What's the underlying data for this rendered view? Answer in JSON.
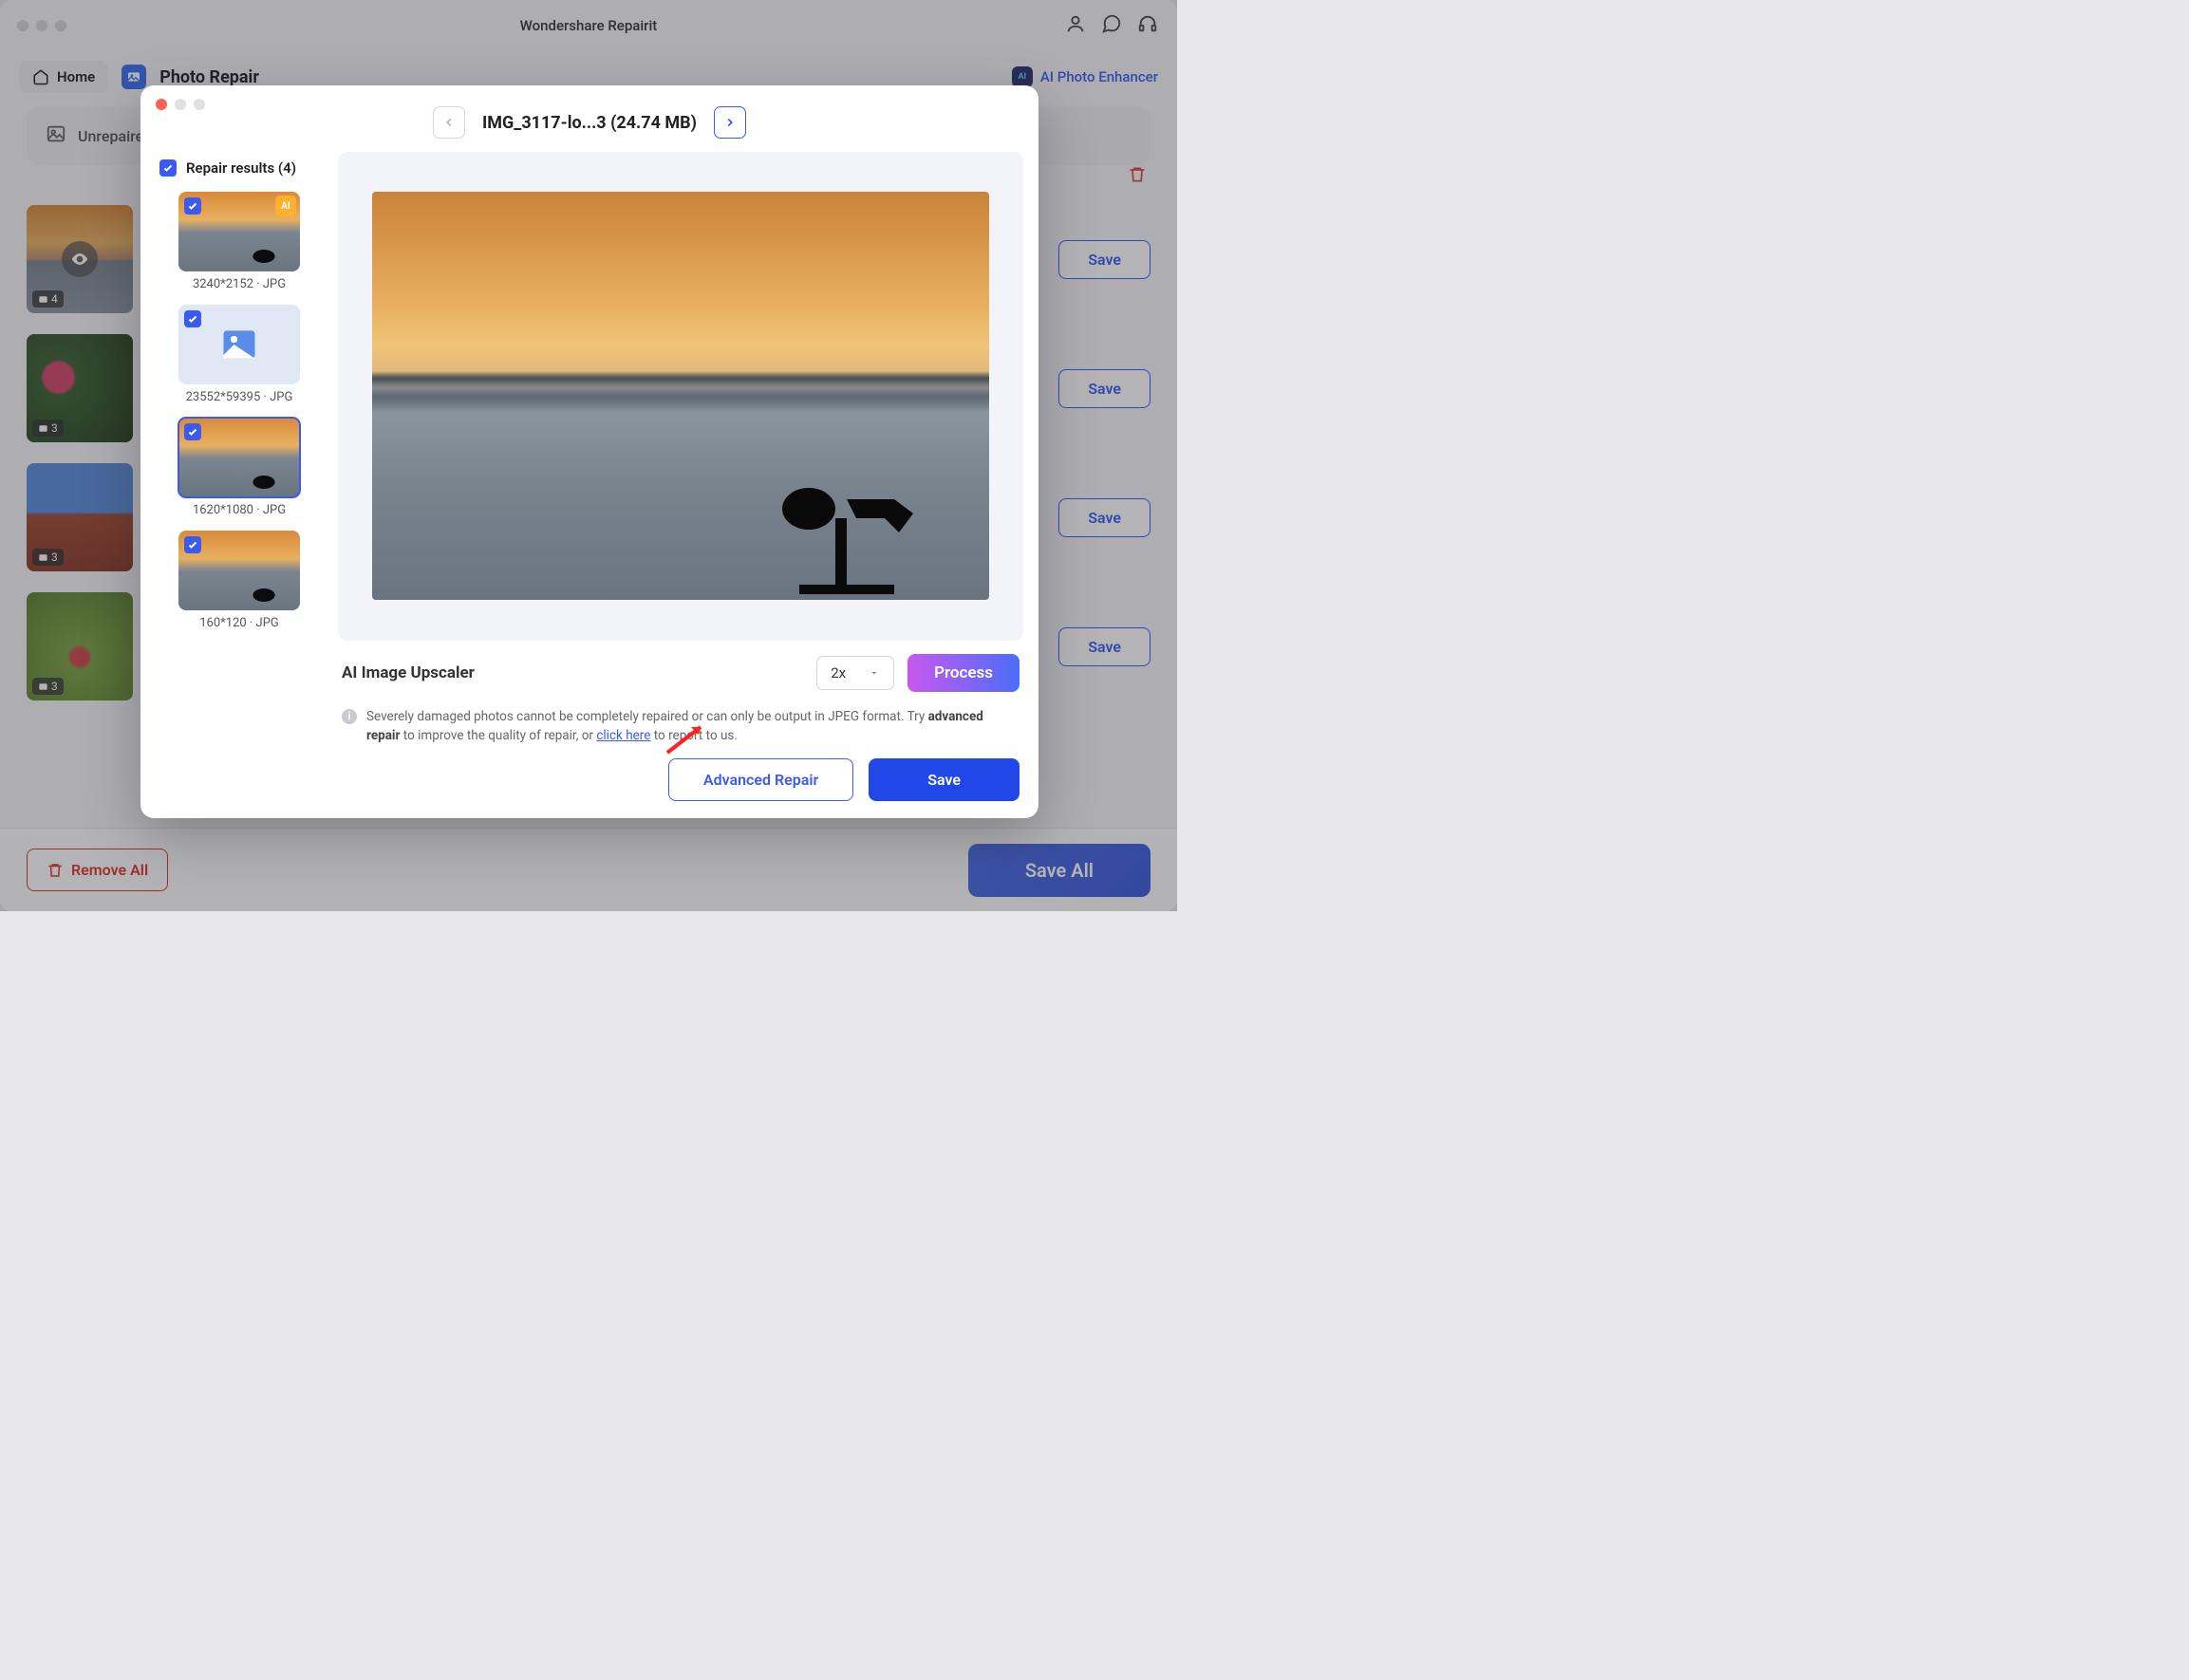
{
  "app": {
    "title": "Wondershare Repairit"
  },
  "toolbar": {
    "home_label": "Home",
    "section_title": "Photo Repair",
    "ai_enhancer_label": "AI Photo Enhancer"
  },
  "background": {
    "unrepaired_label": "Unrepaire",
    "rows": [
      {
        "count": "4",
        "save_label": "Save"
      },
      {
        "count": "3",
        "save_label": "Save"
      },
      {
        "count": "3",
        "save_label": "Save"
      },
      {
        "count": "3",
        "save_label": "Save"
      }
    ]
  },
  "bottom": {
    "remove_all": "Remove All",
    "save_all": "Save All"
  },
  "modal": {
    "title": "IMG_3117-lo...3 (24.74 MB)",
    "results_label": "Repair results (4)",
    "results": [
      {
        "meta": "3240*2152 · JPG",
        "ai_tag": "AI"
      },
      {
        "meta": "23552*59395 · JPG"
      },
      {
        "meta": "1620*1080 · JPG"
      },
      {
        "meta": "160*120 · JPG"
      }
    ],
    "upscaler_label": "AI Image Upscaler",
    "scale_value": "2x",
    "process_label": "Process",
    "info_text_1": "Severely damaged photos cannot be completely repaired or can only be output in JPEG format. Try ",
    "info_strong": "advanced repair",
    "info_text_2": " to improve the quality of repair, or ",
    "info_link": "click here",
    "info_text_3": " to report to us.",
    "advanced_repair": "Advanced Repair",
    "save": "Save"
  }
}
